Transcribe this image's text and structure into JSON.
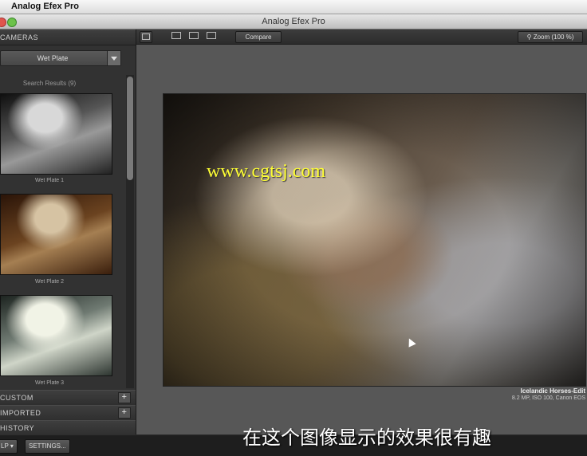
{
  "menubar": {
    "app_name": "Analog Efex Pro"
  },
  "window": {
    "title": "Analog Efex Pro"
  },
  "left_panel": {
    "cameras_header": "CAMERAS",
    "camera_select": "Wet Plate",
    "search_results": "Search Results (9)",
    "thumbnails": [
      {
        "label": "Wet Plate 1"
      },
      {
        "label": "Wet Plate 2"
      },
      {
        "label": "Wet Plate 3"
      }
    ],
    "custom_header": "CUSTOM",
    "imported_header": "IMPORTED",
    "history_header": "HISTORY",
    "plus_symbol": "+"
  },
  "toolbar": {
    "compare_label": "Compare",
    "zoom_label": "Zoom (100 %)"
  },
  "image_info": {
    "name": "Icelandic Horses-Edit",
    "meta": "8.2 MP, ISO 100, Canon EOS"
  },
  "bottom_bar": {
    "help_label": "LP ▾",
    "settings_label": "SETTINGS..."
  },
  "overlay": {
    "watermark": "www.cgtsj.com",
    "subtitle": "在这个图像显示的效果很有趣"
  },
  "colors": {
    "watermark": "#ffff33",
    "panel_bg": "#323232",
    "canvas_bg": "#575757"
  },
  "icons": [
    "dropdown-arrow-icon",
    "fit-icon",
    "single-view-icon",
    "split-view-icon",
    "side-by-side-icon",
    "zoom-magnifier-icon",
    "cursor-icon"
  ]
}
